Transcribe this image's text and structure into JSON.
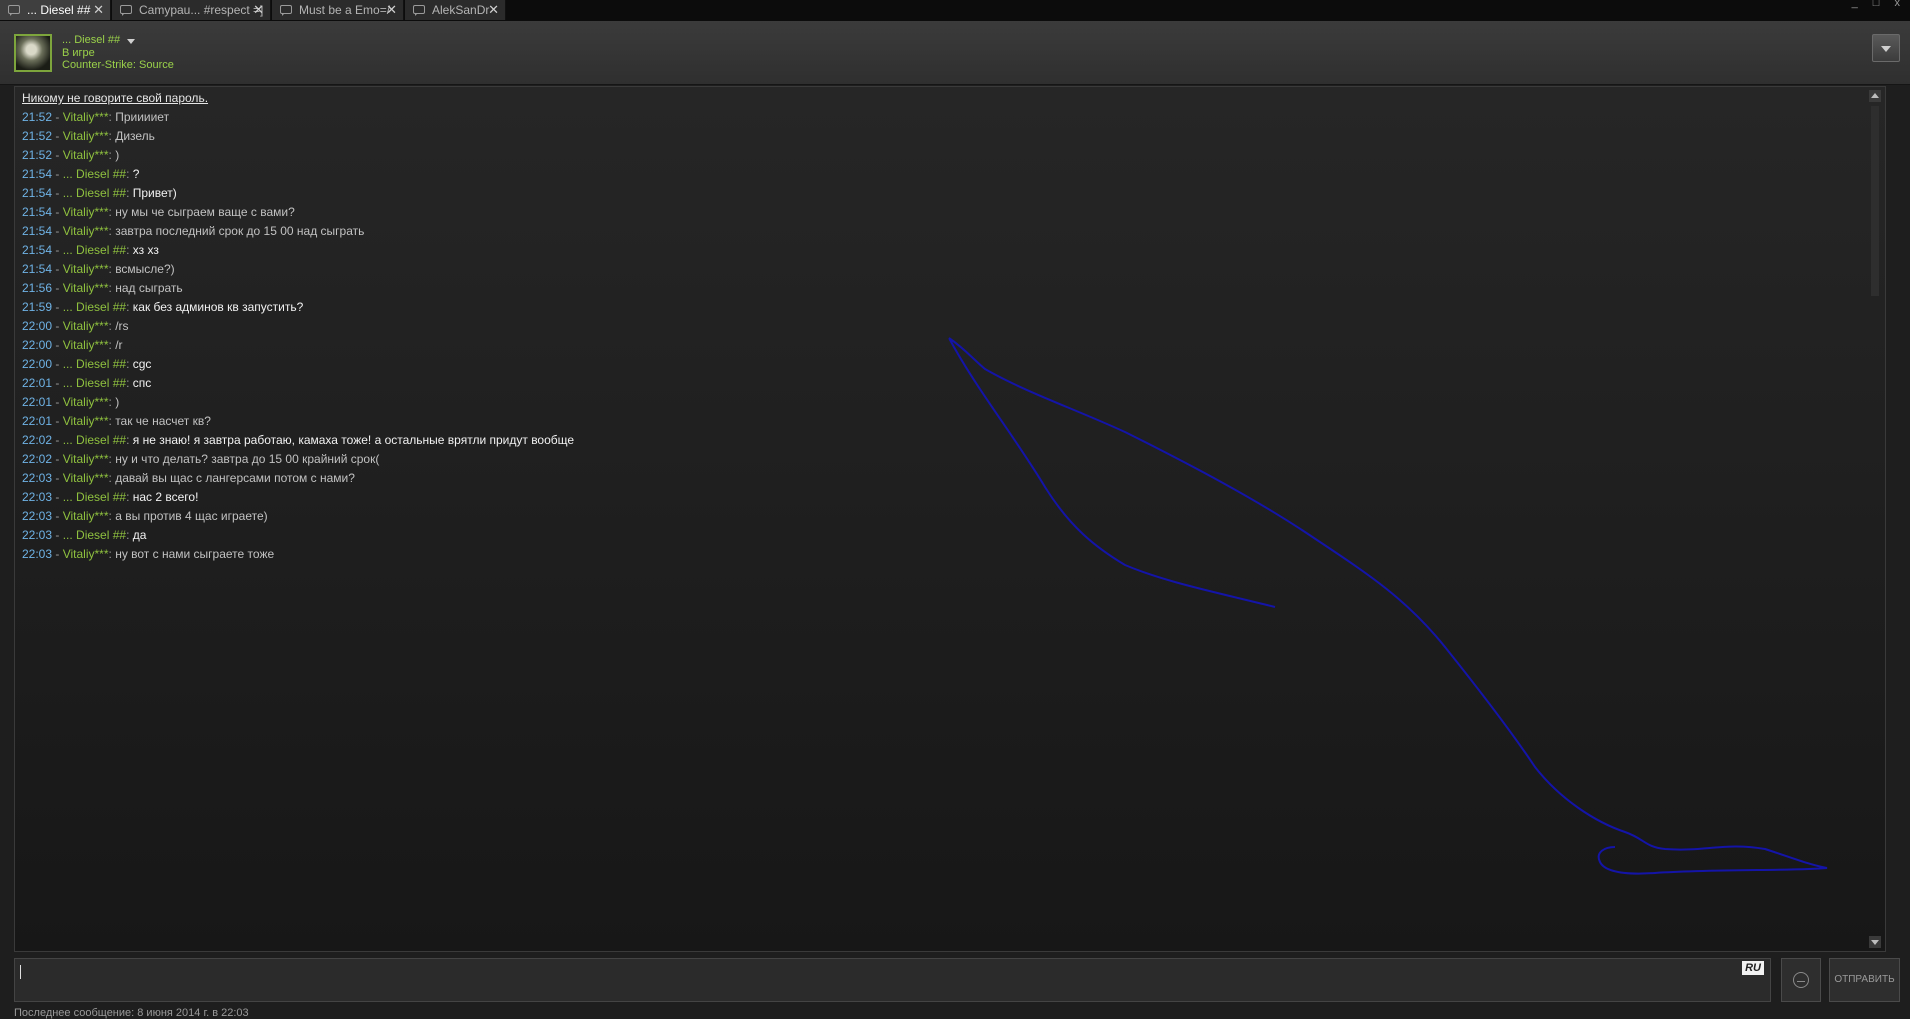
{
  "tabs": [
    {
      "label": "... Diesel ##",
      "close": "✕",
      "active": true
    },
    {
      "label": "Camypau... #respect =]",
      "close": "✕",
      "active": false
    },
    {
      "label": "Must be a Emo=/",
      "close": "✕",
      "active": false
    },
    {
      "label": "AlekSanDr",
      "close": "✕",
      "active": false
    }
  ],
  "window_controls": "_ □ x",
  "friend": {
    "name": "... Diesel ##",
    "status": "В игре",
    "game": "Counter-Strike: Source"
  },
  "chat": {
    "warning": "Никому не говорите свой пароль.",
    "messages": [
      {
        "time": "21:52",
        "sender": "Vitaliy***",
        "text": "Прииииет",
        "mine": false
      },
      {
        "time": "21:52",
        "sender": "Vitaliy***",
        "text": "Дизель",
        "mine": false
      },
      {
        "time": "21:52",
        "sender": "Vitaliy***",
        "text": ")",
        "mine": false
      },
      {
        "time": "21:54",
        "sender": "... Diesel ##",
        "text": "?",
        "mine": true
      },
      {
        "time": "21:54",
        "sender": "... Diesel ##",
        "text": "Привет)",
        "mine": true
      },
      {
        "time": "21:54",
        "sender": "Vitaliy***",
        "text": "ну мы че сыграем ваще с вами?",
        "mine": false
      },
      {
        "time": "21:54",
        "sender": "Vitaliy***",
        "text": "завтра последний срок до 15 00 над сыграть",
        "mine": false
      },
      {
        "time": "21:54",
        "sender": "... Diesel ##",
        "text": "хз хз",
        "mine": true
      },
      {
        "time": "21:54",
        "sender": "Vitaliy***",
        "text": "всмысле?)",
        "mine": false
      },
      {
        "time": "21:56",
        "sender": "Vitaliy***",
        "text": "над сыграть",
        "mine": false
      },
      {
        "time": "21:59",
        "sender": "... Diesel ##",
        "text": "как без админов кв запустить?",
        "mine": true
      },
      {
        "time": "22:00",
        "sender": "Vitaliy***",
        "text": "/rs",
        "mine": false
      },
      {
        "time": "22:00",
        "sender": "Vitaliy***",
        "text": "/r",
        "mine": false
      },
      {
        "time": "22:00",
        "sender": "... Diesel ##",
        "text": "cgc",
        "mine": true
      },
      {
        "time": "22:01",
        "sender": "... Diesel ##",
        "text": "спс",
        "mine": true
      },
      {
        "time": "22:01",
        "sender": "Vitaliy***",
        "text": ")",
        "mine": false
      },
      {
        "time": "22:01",
        "sender": "Vitaliy***",
        "text": "так че  насчет кв?",
        "mine": false
      },
      {
        "time": "22:02",
        "sender": "... Diesel ##",
        "text": "я не знаю! я завтра работаю, камаха тоже! а остальные врятли придут вообще",
        "mine": true
      },
      {
        "time": "22:02",
        "sender": "Vitaliy***",
        "text": "ну и что делать? завтра до 15 00 крайний срок(",
        "mine": false
      },
      {
        "time": "22:03",
        "sender": "Vitaliy***",
        "text": "давай вы щас с лангерсами потом с нами?",
        "mine": false
      },
      {
        "time": "22:03",
        "sender": "... Diesel ##",
        "text": "нас 2 всего!",
        "mine": true
      },
      {
        "time": "22:03",
        "sender": "Vitaliy***",
        "text": "а вы против 4 щас играете)",
        "mine": false
      },
      {
        "time": "22:03",
        "sender": "... Diesel ##",
        "text": "да",
        "mine": true
      },
      {
        "time": "22:03",
        "sender": "Vitaliy***",
        "text": "ну вот с нами сыграете тоже",
        "mine": false
      }
    ]
  },
  "input": {
    "value": "",
    "language": "RU"
  },
  "send_label": "ОТПРАВИТЬ",
  "footer": "Последнее сообщение: 8 июня 2014 г. в 22:03",
  "colors": {
    "timestamp": "#6fb3e6",
    "sender": "#8fc13f",
    "scribble": "#1414a8"
  }
}
